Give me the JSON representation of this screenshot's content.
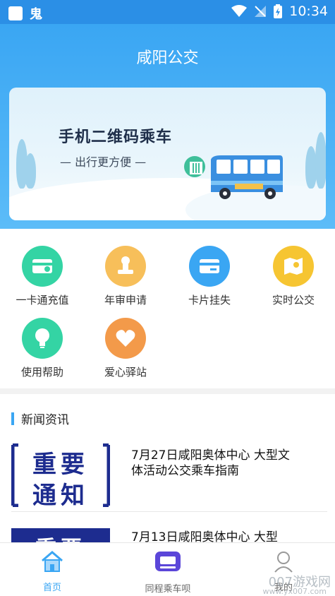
{
  "status_bar": {
    "time": "10:34",
    "notification_glyph": "鬼"
  },
  "header": {
    "title": "咸阳公交"
  },
  "banner": {
    "title": "手机二维码乘车",
    "subtitle": "— 出行更方便 —"
  },
  "services": [
    {
      "label": "一卡通充值",
      "color": "#34d4a4",
      "icon": "card-recharge-icon"
    },
    {
      "label": "年审申请",
      "color": "#f7bf5a",
      "icon": "stamp-icon"
    },
    {
      "label": "卡片挂失",
      "color": "#3aa6f3",
      "icon": "card-lost-icon"
    },
    {
      "label": "实时公交",
      "color": "#f6c532",
      "icon": "map-pin-icon"
    },
    {
      "label": "使用帮助",
      "color": "#34d4a4",
      "icon": "lightbulb-icon"
    },
    {
      "label": "爱心驿站",
      "color": "#f39a4a",
      "icon": "heart-icon"
    }
  ],
  "news": {
    "section_title": "新闻资讯",
    "items": [
      {
        "title": "7月27日咸阳奥体中心 大型文体活动公交乘车指南",
        "thumb_text_top": "重要",
        "thumb_text_bottom": "通知"
      },
      {
        "title": "7月13日咸阳奥体中心 大型",
        "thumb_text_top": "重要",
        "thumb_text_bottom": ""
      }
    ]
  },
  "tabbar": {
    "tabs": [
      {
        "label": "首页",
        "active": true
      },
      {
        "label": "同程乘车呗",
        "active": false
      },
      {
        "label": "我的",
        "active": false
      }
    ]
  },
  "watermark": {
    "text": "007游戏网",
    "url_text": "www.yx007.com"
  },
  "colors": {
    "primary": "#3aa6f3",
    "thumb_navy": "#1d2c8f"
  }
}
